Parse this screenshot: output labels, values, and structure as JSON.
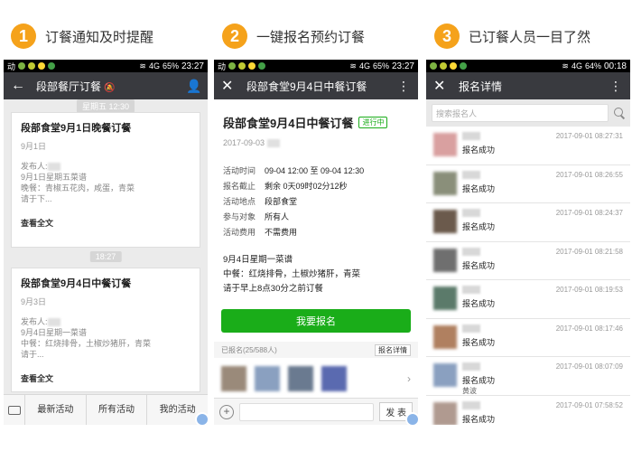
{
  "steps": [
    {
      "num": "1",
      "title": "订餐通知及时提醒"
    },
    {
      "num": "2",
      "title": "一键报名预约订餐"
    },
    {
      "num": "3",
      "title": "已订餐人员一目了然"
    }
  ],
  "phone1": {
    "status": {
      "signal": "4G",
      "battery": "65%",
      "time": "23:27"
    },
    "title": "段部餐厅订餐",
    "msgs": [
      {
        "time": "星期五 12:30",
        "title": "段部食堂9月1日晚餐订餐",
        "date": "9月1日",
        "publisher": "发布人:",
        "lines": [
          "9月1日星期五菜谱",
          "晚餐：青椒五花肉，咸蛋，青菜",
          "请于下..."
        ],
        "more": "查看全文"
      },
      {
        "time": "18:27",
        "title": "段部食堂9月4日中餐订餐",
        "date": "9月3日",
        "publisher": "发布人:",
        "lines": [
          "9月4日星期一菜谱",
          "中餐：红烧排骨，土椒炒猪肝，青菜",
          "请于..."
        ],
        "more": "查看全文"
      }
    ],
    "menu": [
      "最新活动",
      "所有活动",
      "我的活动"
    ]
  },
  "phone2": {
    "status": {
      "signal": "4G",
      "battery": "65%",
      "time": "23:27"
    },
    "title": "段部食堂9月4日中餐订餐",
    "event_title": "段部食堂9月4日中餐订餐",
    "tag": "进行中",
    "date": "2017-09-03",
    "info": [
      {
        "k": "活动时间",
        "v": "09-04 12:00 至 09-04 12:30"
      },
      {
        "k": "报名截止",
        "v": "剩余 0天09时02分12秒"
      },
      {
        "k": "活动地点",
        "v": "段部食堂"
      },
      {
        "k": "参与对象",
        "v": "所有人"
      },
      {
        "k": "活动费用",
        "v": "不需费用"
      }
    ],
    "menu_lines": [
      "9月4日星期一菜谱",
      "中餐：红烧排骨，土椒炒猪肝，青菜",
      "请于早上8点30分之前订餐"
    ],
    "join": "我要报名",
    "joined": "已报名(25/588人)",
    "detail": "报名详情",
    "send": "发 表"
  },
  "phone3": {
    "status": {
      "signal": "4G",
      "battery": "64%",
      "time": "00:18"
    },
    "title": "报名详情",
    "search_placeholder": "搜索报名人",
    "rows": [
      {
        "status": "报名成功",
        "time": "2017-09-01 08:27:31",
        "color": "#d9a0a0"
      },
      {
        "status": "报名成功",
        "time": "2017-09-01 08:26:55",
        "color": "#8a8f7a"
      },
      {
        "status": "报名成功",
        "time": "2017-09-01 08:24:37",
        "color": "#6b5a4c"
      },
      {
        "status": "报名成功",
        "time": "2017-09-01 08:21:58",
        "color": "#6f6f6f"
      },
      {
        "status": "报名成功",
        "time": "2017-09-01 08:19:53",
        "color": "#5b7a6a"
      },
      {
        "status": "报名成功",
        "time": "2017-09-01 08:17:46",
        "color": "#b08060"
      },
      {
        "status": "报名成功",
        "time": "2017-09-01 08:07:09",
        "color": "#8aa0c0",
        "note": "黄波"
      },
      {
        "status": "报名成功",
        "time": "2017-09-01 07:58:52",
        "color": "#b09a90"
      }
    ]
  },
  "colors": {
    "accent": "#f5a21b",
    "green": "#1aad19",
    "navbar": "#393a3f"
  }
}
